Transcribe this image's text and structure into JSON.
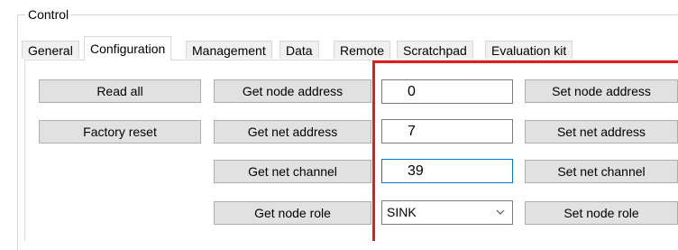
{
  "group": {
    "title": "Control"
  },
  "tabs": [
    {
      "label": "General"
    },
    {
      "label": "Configuration"
    },
    {
      "label": "Management"
    },
    {
      "label": "Data"
    },
    {
      "label": "Remote"
    },
    {
      "label": "Scratchpad"
    },
    {
      "label": "Evaluation kit"
    }
  ],
  "active_tab": "Configuration",
  "left_buttons": {
    "read_all": "Read all",
    "factory_reset": "Factory reset"
  },
  "get_buttons": {
    "node_address": "Get node address",
    "net_address": "Get net address",
    "net_channel": "Get net channel",
    "node_role": "Get node role"
  },
  "fields": {
    "node_address": "0",
    "net_address": "7",
    "net_channel": "39",
    "node_role": "SINK"
  },
  "set_buttons": {
    "node_address": "Set node address",
    "net_address": "Set net address",
    "net_channel": "Set net channel",
    "node_role": "Set node role"
  },
  "colors": {
    "highlight_border": "#e11d1d",
    "focus_border": "#0078d7"
  },
  "icons": {
    "dropdown": "chevron-down-icon"
  }
}
